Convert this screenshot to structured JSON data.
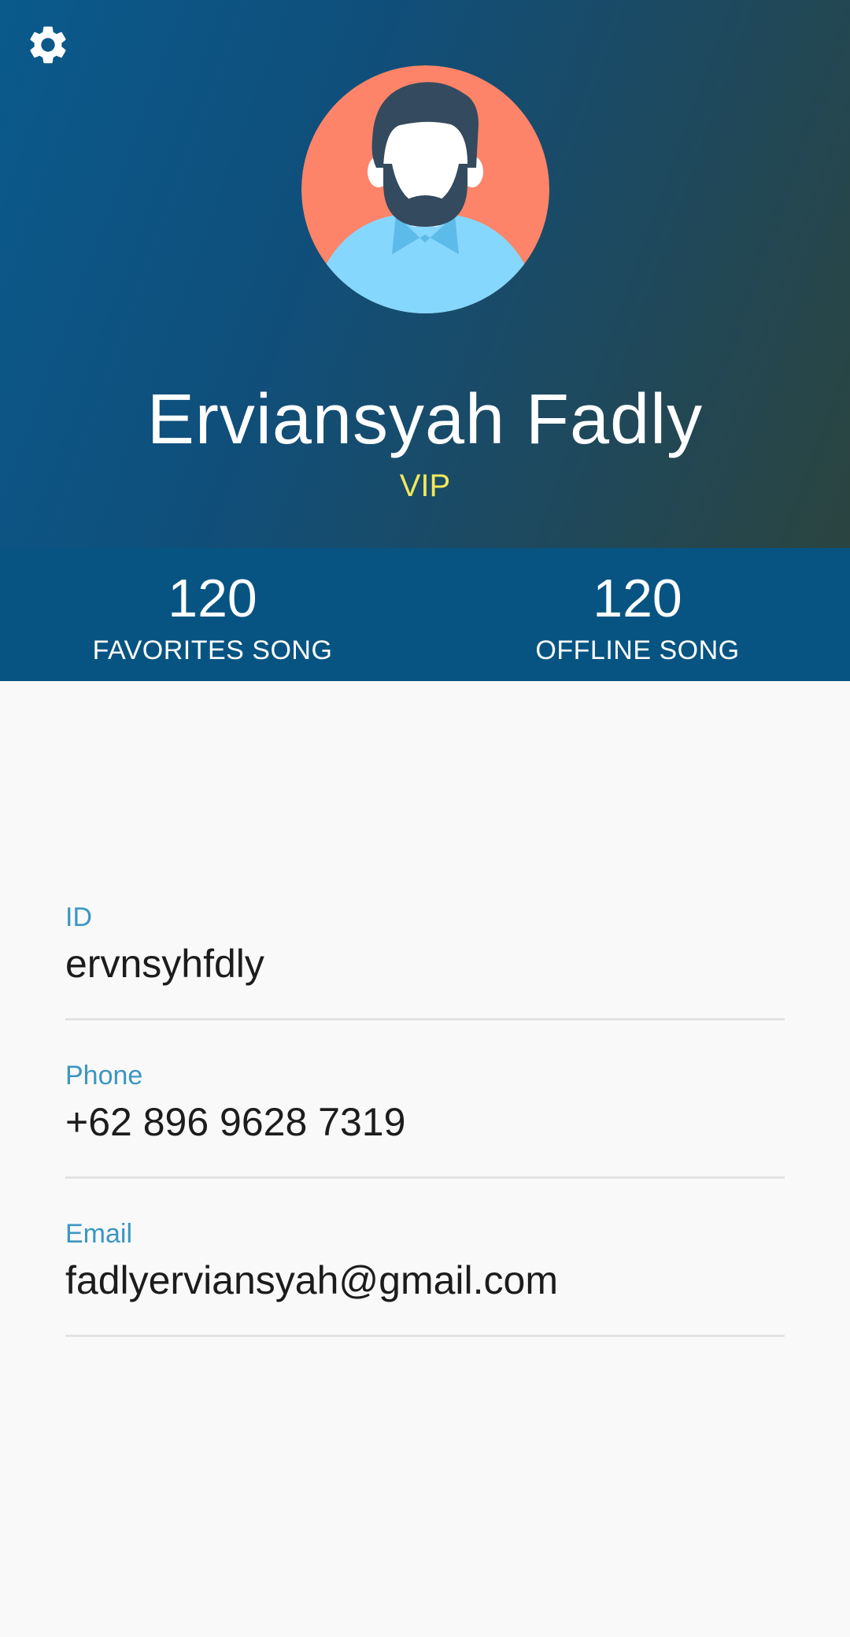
{
  "header": {
    "settings_icon": "gear-icon",
    "avatar_icon": "user-avatar-icon",
    "name": "Erviansyah Fadly",
    "tier": "VIP",
    "colors": {
      "gradient_start": "#0a5a8c",
      "gradient_end": "#2b4440",
      "tier": "#f2e85a"
    }
  },
  "stats": [
    {
      "value": "120",
      "label": "FAVORITES SONG"
    },
    {
      "value": "120",
      "label": "OFFLINE SONG"
    }
  ],
  "profile_fields": [
    {
      "label": "ID",
      "value": "ervnsyhfdly"
    },
    {
      "label": "Phone",
      "value": "+62  896 9628 7319"
    },
    {
      "label": "Email",
      "value": "fadlyerviansyah@gmail.com"
    }
  ],
  "colors": {
    "stats_bar": "#075482",
    "field_label": "#3c96c2",
    "background": "#f9f9f9"
  }
}
